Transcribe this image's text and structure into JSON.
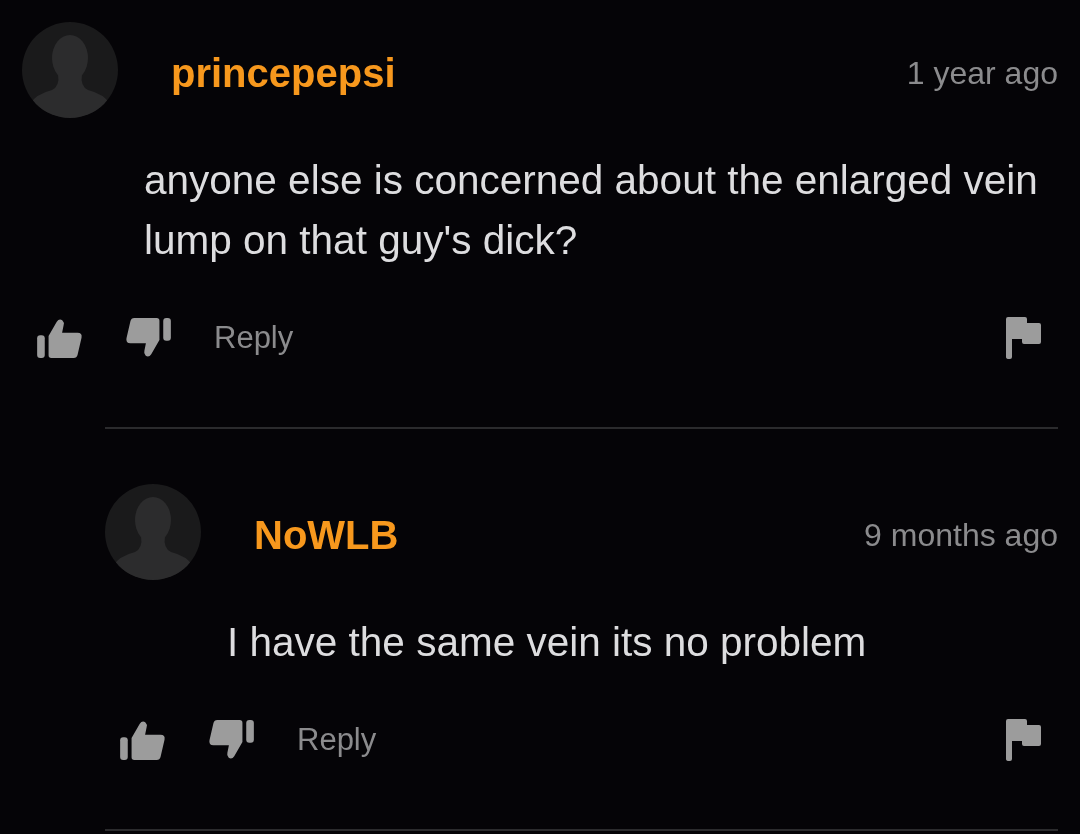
{
  "comments": [
    {
      "author": "princepepsi",
      "time": "1 year ago",
      "text": "anyone else is concerned about the enlarged vein lump on that guy's dick?",
      "reply_label": "Reply",
      "children": [
        {
          "author": "NoWLB",
          "time": "9 months ago",
          "text": "I have the same vein its no problem",
          "reply_label": "Reply"
        }
      ]
    }
  ]
}
